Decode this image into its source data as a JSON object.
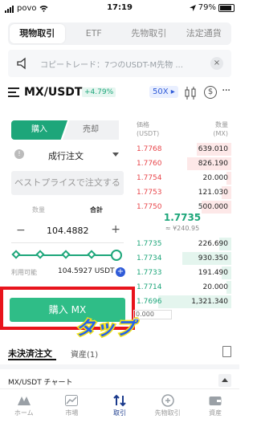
{
  "status_bar": {
    "carrier": "povo",
    "time": "17:19",
    "battery": "79%"
  },
  "tabs": [
    {
      "label": "現物取引",
      "active": true
    },
    {
      "label": "ETF",
      "active": false
    },
    {
      "label": "先物取引",
      "active": false
    },
    {
      "label": "法定通貨",
      "active": false
    }
  ],
  "notice": {
    "text": "コピートレード：7つのUSDT-M先物 ...",
    "close": "×"
  },
  "pair": {
    "symbol": "MX/USDT",
    "change": "+4.79%",
    "leverage": "50X ▸",
    "dollar": "$",
    "more": "···"
  },
  "order": {
    "buy_tab": "購入",
    "sell_tab": "売却",
    "type": "成行注文",
    "info_icon": "!",
    "best_price_placeholder": "ベストプライスで注文する",
    "amount_label": "数量",
    "total_label": "合計",
    "minus": "−",
    "plus": "+",
    "quantity": "104.4882",
    "slider_percent": 100,
    "available_label": "利用可能",
    "available_value": "104.5927 USDT",
    "buy_button": "購入 MX"
  },
  "annotation": {
    "tap_label": "タップ"
  },
  "orderbook": {
    "price_header": "価格",
    "price_unit": "(USDT)",
    "qty_header": "数量",
    "qty_unit": "(MX)",
    "asks": [
      {
        "price": "1.7768",
        "qty": "639.010",
        "depth": 0.35
      },
      {
        "price": "1.7760",
        "qty": "826.190",
        "depth": 0.45
      },
      {
        "price": "1.7754",
        "qty": "20.000",
        "depth": 0.05
      },
      {
        "price": "1.7753",
        "qty": "121.030",
        "depth": 0.1
      },
      {
        "price": "1.7750",
        "qty": "500.000",
        "depth": 0.3
      }
    ],
    "mid_price": "1.7735",
    "mid_fiat": "≈ ¥240.95",
    "bids": [
      {
        "price": "1.7735",
        "qty": "226.690",
        "depth": 0.12
      },
      {
        "price": "1.7734",
        "qty": "930.350",
        "depth": 0.5
      },
      {
        "price": "1.7733",
        "qty": "191.490",
        "depth": 0.1
      },
      {
        "price": "1.7714",
        "qty": "20.000",
        "depth": 0.05
      },
      {
        "price": "1.7696",
        "qty": "1,321.340",
        "depth": 0.75
      }
    ],
    "depth_value": "0.000"
  },
  "lower": {
    "tab_open_orders": "未決済注文",
    "tab_assets": "資産(1)",
    "chart_title": "MX/USDT チャート"
  },
  "bottom_nav": [
    {
      "label": "ホーム",
      "icon": "home-icon",
      "active": false
    },
    {
      "label": "市場",
      "icon": "market-icon",
      "active": false
    },
    {
      "label": "取引",
      "icon": "trade-icon",
      "active": true
    },
    {
      "label": "先物取引",
      "icon": "futures-icon",
      "active": false
    },
    {
      "label": "資産",
      "icon": "wallet-icon",
      "active": false
    }
  ],
  "colors": {
    "green": "#1da67a",
    "red": "#e8454a",
    "blue": "#2f5bd8",
    "highlight": "#e8141c"
  }
}
